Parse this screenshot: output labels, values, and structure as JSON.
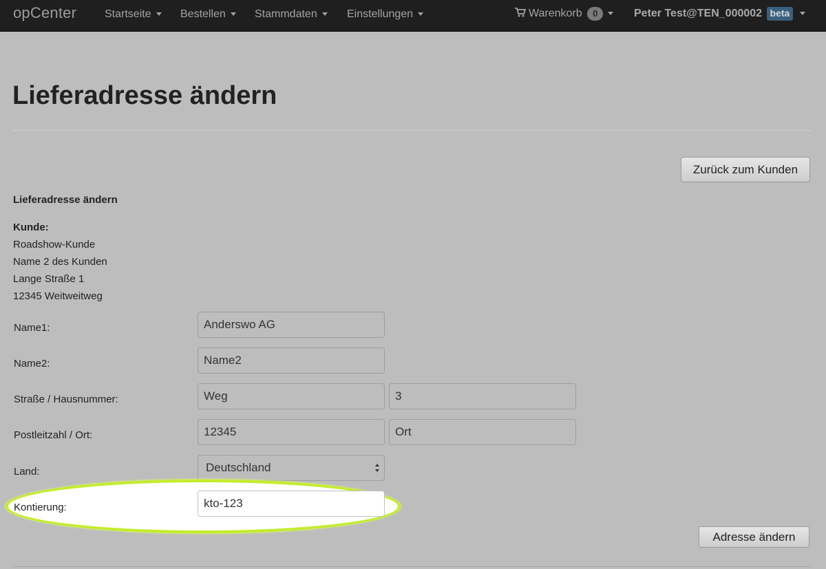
{
  "navbar": {
    "brand": "opCenter",
    "items": [
      {
        "label": "Startseite"
      },
      {
        "label": "Bestellen"
      },
      {
        "label": "Stammdaten"
      },
      {
        "label": "Einstellungen"
      }
    ],
    "cart": {
      "label": "Warenkorb",
      "count": "0"
    },
    "user": {
      "name": "Peter Test@TEN_000002",
      "badge": "beta"
    }
  },
  "page": {
    "title": "Lieferadresse ändern",
    "back_button": "Zurück zum Kunden",
    "section_heading": "Lieferadresse ändern"
  },
  "customer": {
    "label": "Kunde:",
    "lines": [
      "Roadshow-Kunde",
      "Name 2 des Kunden",
      "Lange Straße 1",
      "12345 Weitweitweg"
    ]
  },
  "form": {
    "name1": {
      "label": "Name1:",
      "value": "Anderswo AG"
    },
    "name2": {
      "label": "Name2:",
      "value": "Name2"
    },
    "street": {
      "label": "Straße / Hausnummer:",
      "street_value": "Weg",
      "number_value": "3"
    },
    "city": {
      "label": "Postleitzahl / Ort:",
      "zip_value": "12345",
      "city_value": "Ort"
    },
    "country": {
      "label": "Land:",
      "selected": "Deutschland"
    },
    "kontierung": {
      "label": "Kontierung:",
      "value": "kto-123"
    },
    "submit": "Adresse ändern"
  },
  "colors": {
    "navbar_bg": "#1f1f1f",
    "page_bg": "#bdbdbd",
    "highlight": "#c4ec2c",
    "beta_badge": "#3b5f7d"
  }
}
